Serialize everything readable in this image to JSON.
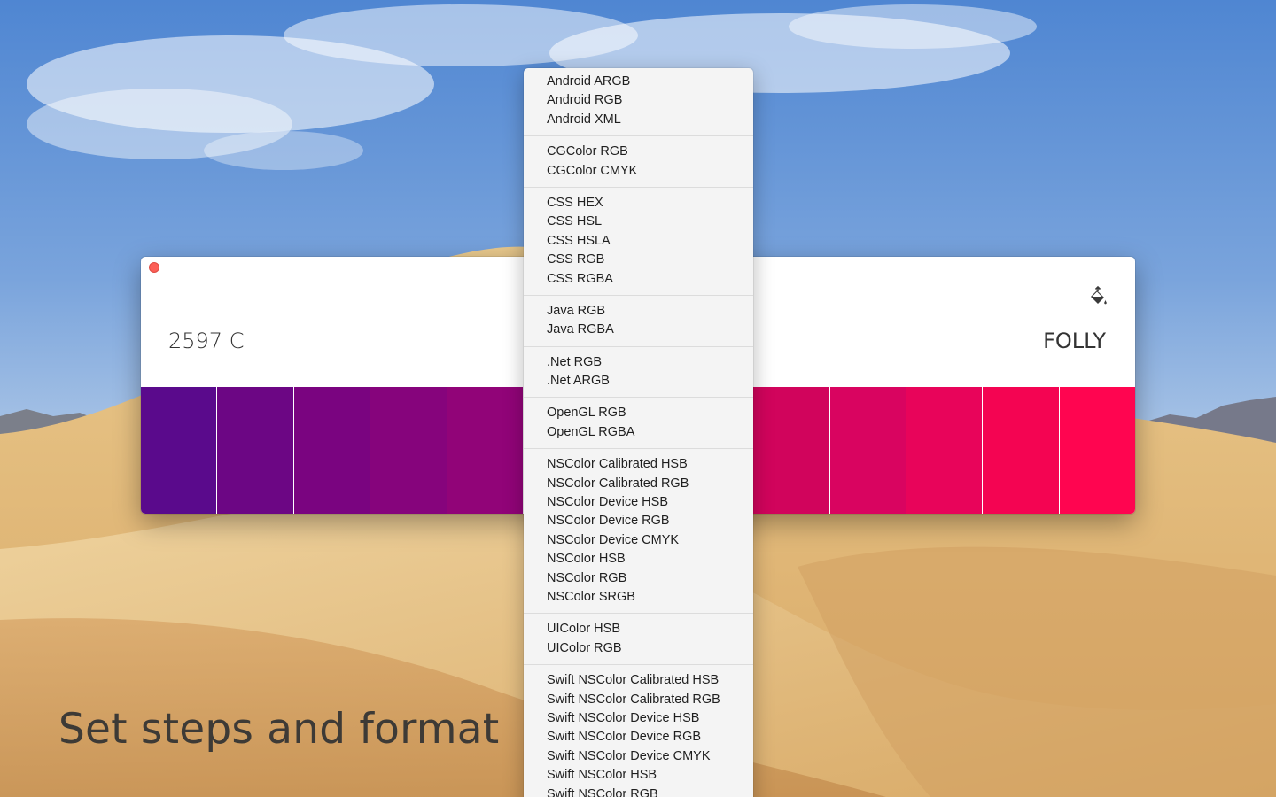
{
  "caption": "Set steps and format",
  "window": {
    "left_color_name": "2597 C",
    "right_color_name": "FOLLY",
    "swatches": [
      "#5a0a8c",
      "#6c0684",
      "#7a0480",
      "#86047c",
      "#910478",
      "#a20470",
      "#b10468",
      "#c20462",
      "#d1045c",
      "#d90460",
      "#e8045a",
      "#f40452",
      "#ff0550"
    ]
  },
  "format_menu": {
    "groups": [
      [
        "Android ARGB",
        "Android RGB",
        "Android XML"
      ],
      [
        "CGColor RGB",
        "CGColor CMYK"
      ],
      [
        "CSS HEX",
        "CSS HSL",
        "CSS HSLA",
        "CSS RGB",
        "CSS RGBA"
      ],
      [
        "Java RGB",
        "Java RGBA"
      ],
      [
        ".Net RGB",
        ".Net ARGB"
      ],
      [
        "OpenGL RGB",
        "OpenGL RGBA"
      ],
      [
        "NSColor Calibrated HSB",
        "NSColor Calibrated RGB",
        "NSColor Device HSB",
        "NSColor Device RGB",
        "NSColor Device CMYK",
        "NSColor HSB",
        "NSColor RGB",
        "NSColor SRGB"
      ],
      [
        "UIColor HSB",
        "UIColor RGB"
      ],
      [
        "Swift NSColor Calibrated HSB",
        "Swift NSColor Calibrated RGB",
        "Swift NSColor Device HSB",
        "Swift NSColor Device RGB",
        "Swift NSColor Device CMYK",
        "Swift NSColor HSB",
        "Swift NSColor RGB"
      ]
    ]
  }
}
